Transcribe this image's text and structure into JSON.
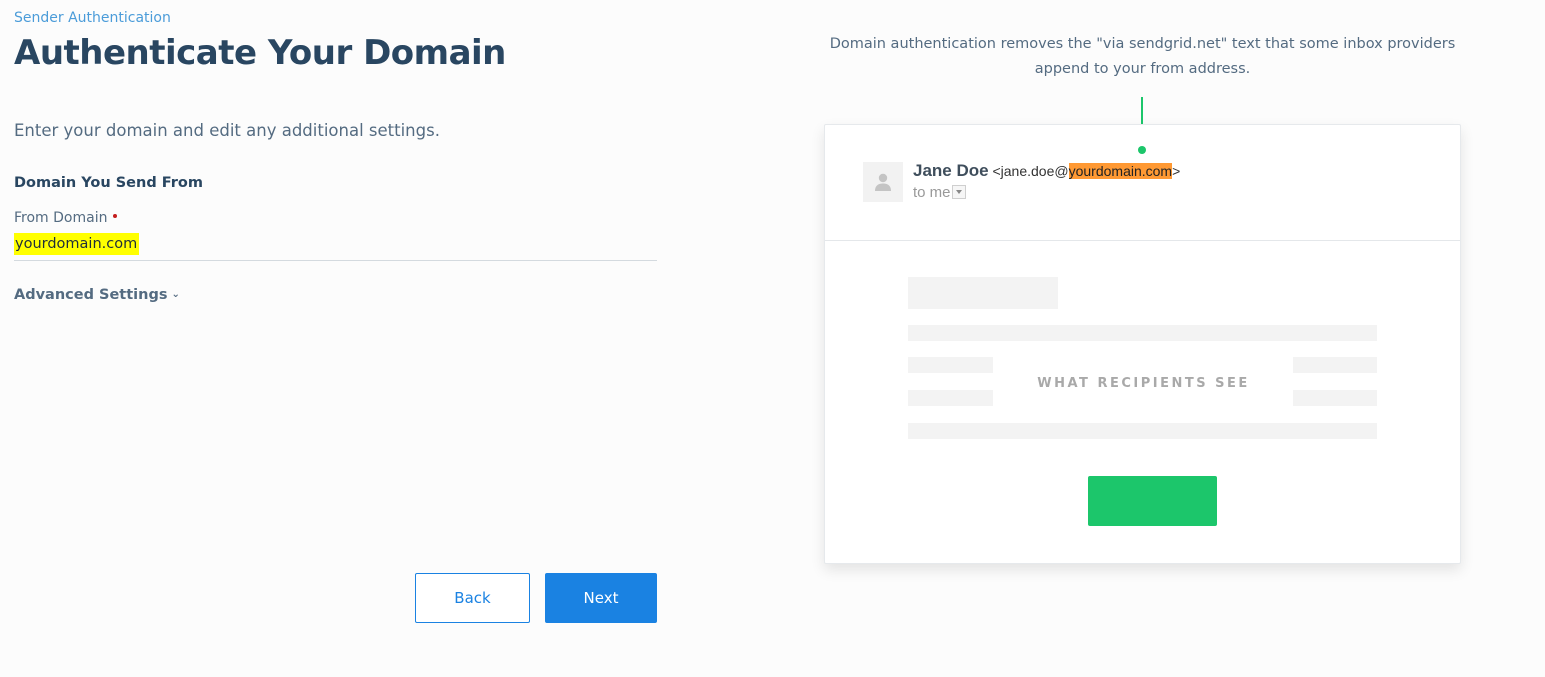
{
  "breadcrumb": {
    "label": "Sender Authentication"
  },
  "page": {
    "title": "Authenticate Your Domain",
    "instructions": "Enter your domain and edit any additional settings."
  },
  "form": {
    "section_heading": "Domain You Send From",
    "from_domain_label": "From Domain",
    "from_domain_value": "yourdomain.com",
    "advanced_settings_label": "Advanced Settings"
  },
  "buttons": {
    "back": "Back",
    "next": "Next"
  },
  "preview": {
    "explanation": "Domain authentication removes the \"via sendgrid.net\" text that some inbox providers append to your from address.",
    "sender_name": "Jane Doe",
    "email_prefix": "<jane.doe@",
    "email_domain": "yourdomain.com",
    "email_suffix": ">",
    "to_text": "to me",
    "recipients_label": "WHAT RECIPIENTS SEE"
  },
  "icons": {
    "avatar": "person-icon",
    "advanced_toggle": "chevron-down-icon",
    "to_dropdown": "dropdown-arrow-icon"
  },
  "colors": {
    "accent_blue": "#1a82e2",
    "title_navy": "#294661",
    "domain_highlight": "#ffff00",
    "preview_domain_highlight": "#ff9933",
    "success_green": "#1cc66b",
    "required_red": "#c41e1e"
  }
}
